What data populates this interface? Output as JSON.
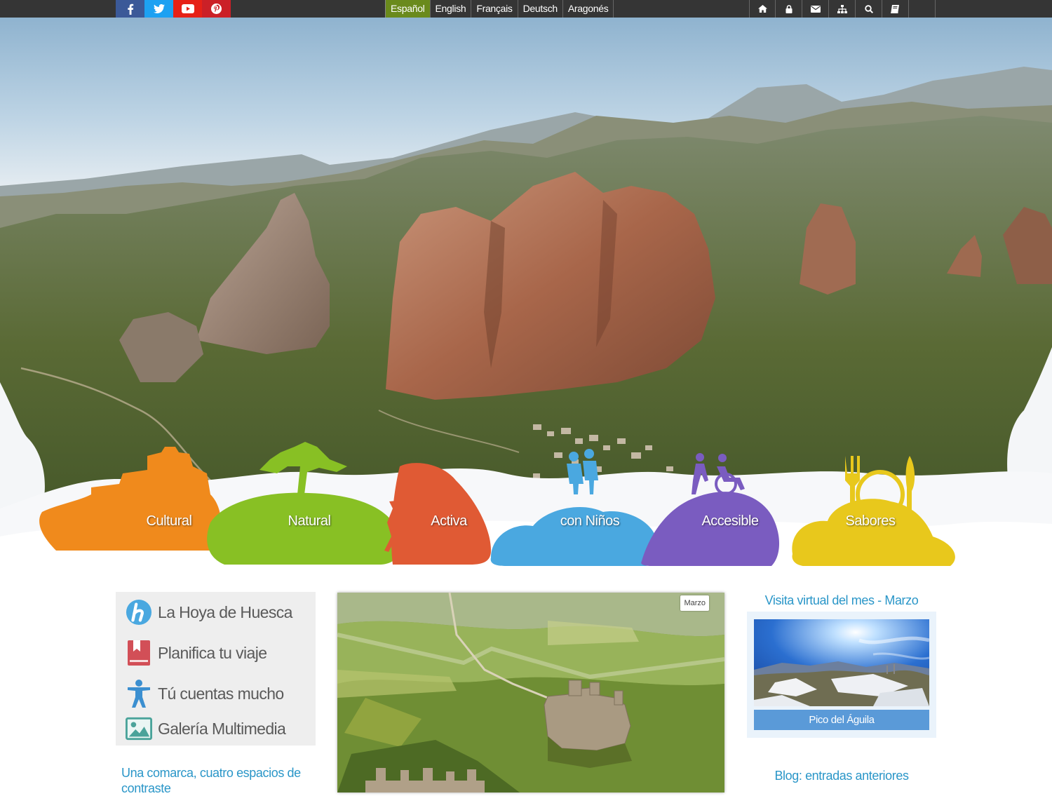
{
  "social": [
    {
      "name": "facebook",
      "glyph": "f",
      "color": "#3b5998"
    },
    {
      "name": "twitter",
      "glyph": "t",
      "color": "#1da1f2"
    },
    {
      "name": "youtube",
      "glyph": "▶",
      "color": "#e62117"
    },
    {
      "name": "pinterest",
      "glyph": "P",
      "color": "#cb2027"
    }
  ],
  "languages": [
    "Español",
    "English",
    "Français",
    "Deutsch",
    "Aragonés"
  ],
  "active_language": "Español",
  "tools": [
    "home-icon",
    "lock-icon",
    "envelope-icon",
    "sitemap-icon",
    "search-icon",
    "book-icon",
    "blank"
  ],
  "categories": [
    {
      "label": "Cultural",
      "color": "#f08a1c"
    },
    {
      "label": "Natural",
      "color": "#88c024"
    },
    {
      "label": "Activa",
      "color": "#e05a34"
    },
    {
      "label": "con Niños",
      "color": "#4aa8e0"
    },
    {
      "label": "Accesible",
      "color": "#7a5cc0"
    },
    {
      "label": "Sabores",
      "color": "#e8c81c"
    }
  ],
  "left_menu": [
    {
      "label": "La Hoya de Huesca",
      "icon": "hoya-logo-icon"
    },
    {
      "label": "Planifica tu viaje",
      "icon": "bookmark-book-icon"
    },
    {
      "label": "Tú cuentas mucho",
      "icon": "person-icon"
    },
    {
      "label": "Galería Multimedia",
      "icon": "image-gallery-icon"
    }
  ],
  "comarca_text": "Una comarca, cuatro espacios de contraste",
  "feature_badge": "Marzo",
  "virtual_visit": {
    "title": "Visita virtual del mes - Marzo",
    "caption": "Pico del Águila"
  },
  "blog_title": "Blog: entradas anteriores",
  "colors": {
    "topbar": "#353535",
    "active_lang": "#6a8a1c",
    "link_blue": "#2a96c8",
    "caption_blue": "#5a9ad8"
  }
}
